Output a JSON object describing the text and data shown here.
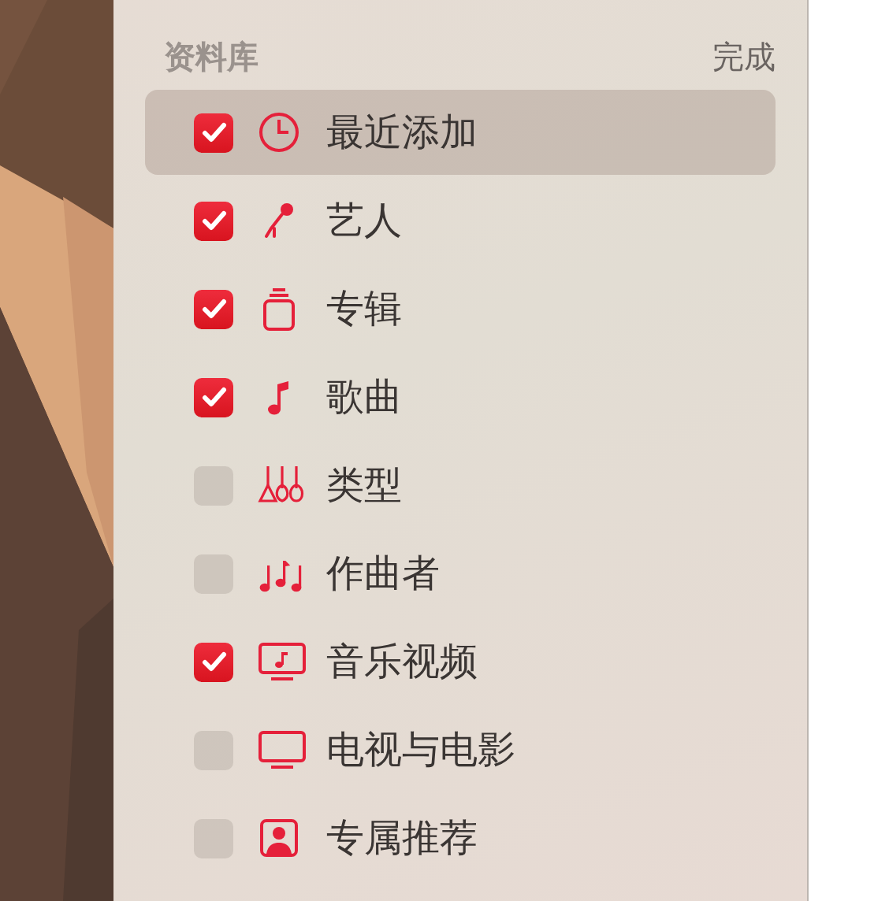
{
  "library": {
    "title": "资料库",
    "done_button": "完成",
    "items": [
      {
        "label": "最近添加",
        "kind": "clock",
        "checked": true,
        "selected": true
      },
      {
        "label": "艺人",
        "kind": "microphone",
        "checked": true,
        "selected": false
      },
      {
        "label": "专辑",
        "kind": "album",
        "checked": true,
        "selected": false
      },
      {
        "label": "歌曲",
        "kind": "note",
        "checked": true,
        "selected": false
      },
      {
        "label": "类型",
        "kind": "guitars",
        "checked": false,
        "selected": false
      },
      {
        "label": "作曲者",
        "kind": "notes",
        "checked": false,
        "selected": false
      },
      {
        "label": "音乐视频",
        "kind": "video",
        "checked": true,
        "selected": false
      },
      {
        "label": "电视与电影",
        "kind": "tv",
        "checked": false,
        "selected": false
      },
      {
        "label": "专属推荐",
        "kind": "person",
        "checked": false,
        "selected": false
      }
    ]
  }
}
